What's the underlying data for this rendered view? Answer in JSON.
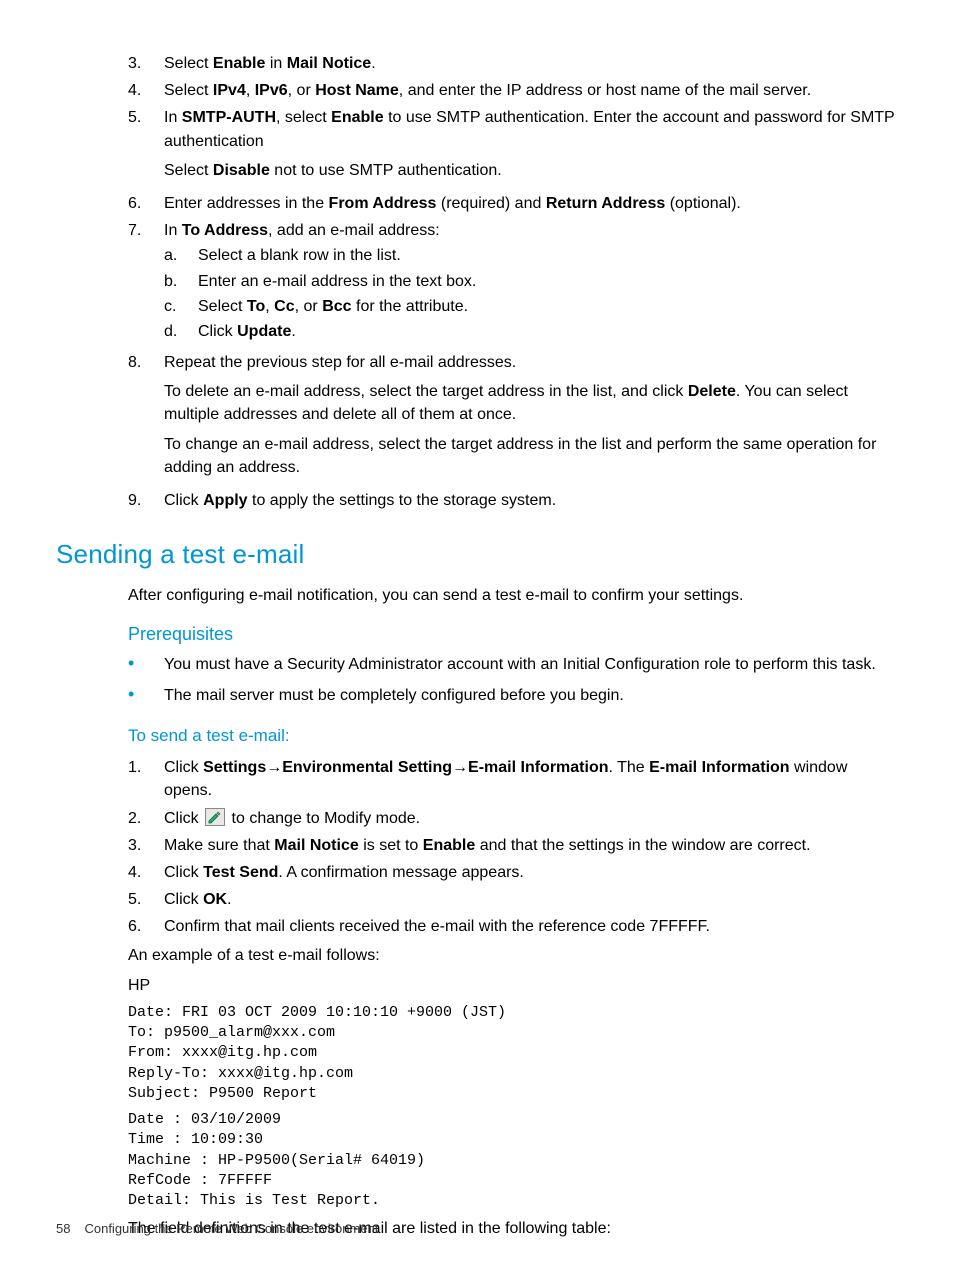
{
  "steps_top": {
    "s3": {
      "num": "3.",
      "pre": "Select ",
      "b1": "Enable",
      "mid": " in ",
      "b2": "Mail Notice",
      "post": "."
    },
    "s4": {
      "num": "4.",
      "pre": "Select ",
      "b1": "IPv4",
      "c1": ", ",
      "b2": "IPv6",
      "c2": ", or ",
      "b3": "Host Name",
      "post": ", and enter the IP address or host name of the mail server."
    },
    "s5": {
      "num": "5.",
      "line1_pre": "In ",
      "line1_b1": "SMTP-AUTH",
      "line1_mid": ", select ",
      "line1_b2": "Enable",
      "line1_post": " to use SMTP authentication. Enter the account and password for SMTP authentication",
      "line2_pre": "Select ",
      "line2_b": "Disable",
      "line2_post": " not to use SMTP authentication."
    },
    "s6": {
      "num": "6.",
      "pre": "Enter addresses in the ",
      "b1": "From Address",
      "mid": " (required) and ",
      "b2": "Return Address",
      "post": " (optional)."
    },
    "s7": {
      "num": "7.",
      "pre": "In ",
      "b1": "To Address",
      "post": ", add an e-mail address:",
      "a": {
        "l": "a.",
        "t": "Select a blank row in the list."
      },
      "b": {
        "l": "b.",
        "t": "Enter an e-mail address in the text box."
      },
      "c": {
        "l": "c.",
        "pre": "Select ",
        "b1": "To",
        "c1": ", ",
        "b2": "Cc",
        "c2": ", or ",
        "b3": "Bcc",
        "post": " for the attribute."
      },
      "d": {
        "l": "d.",
        "pre": "Click ",
        "b1": "Update",
        "post": "."
      }
    },
    "s8": {
      "num": "8.",
      "line1": "Repeat the previous step for all e-mail addresses.",
      "line2_pre": "To delete an e-mail address, select the target address in the list, and click ",
      "line2_b": "Delete",
      "line2_post": ". You can select multiple addresses and delete all of them at once.",
      "line3": "To change an e-mail address, select the target address in the list and perform the same operation for adding an address."
    },
    "s9": {
      "num": "9.",
      "pre": "Click ",
      "b1": "Apply",
      "post": " to apply the settings to the storage system."
    }
  },
  "h2_send": "Sending a test e-mail",
  "intro_send": "After configuring e-mail notification, you can send a test e-mail to confirm your settings.",
  "h3_prereq": "Prerequisites",
  "prereq": {
    "p1": "You must have a Security Administrator account with an Initial Configuration role to perform this task.",
    "p2": "The mail server must be completely configured before you begin."
  },
  "h4_tosend": "To send a test e-mail:",
  "send_steps": {
    "s1": {
      "num": "1.",
      "pre": "Click ",
      "b1": "Settings",
      "arr1": "→",
      "b2": "Environmental Setting",
      "arr2": "→",
      "b3": "E-mail Information",
      "mid": ". The ",
      "b4": "E-mail Information",
      "post": " window opens."
    },
    "s2": {
      "num": "2.",
      "pre": "Click ",
      "post": " to change to Modify mode."
    },
    "s3": {
      "num": "3.",
      "pre": "Make sure that ",
      "b1": "Mail Notice",
      "mid": " is set to ",
      "b2": "Enable",
      "post": " and that the settings in the window are correct."
    },
    "s4": {
      "num": "4.",
      "pre": "Click ",
      "b1": "Test Send",
      "post": ". A confirmation message appears."
    },
    "s5": {
      "num": "5.",
      "pre": "Click ",
      "b1": "OK",
      "post": "."
    },
    "s6": {
      "num": "6.",
      "t": "Confirm that mail clients received the e-mail with the reference code 7FFFFF."
    }
  },
  "example_intro": "An example of a test e-mail follows:",
  "hp_label": "HP",
  "code_block1": "Date: FRI 03 OCT 2009 10:10:10 +9000 (JST)\nTo: p9500_alarm@xxx.com\nFrom: xxxx@itg.hp.com\nReply-To: xxxx@itg.hp.com\nSubject: P9500 Report",
  "code_block2": "Date : 03/10/2009\nTime : 10:09:30\nMachine : HP-P9500(Serial# 64019)\nRefCode : 7FFFFF\nDetail: This is Test Report.",
  "table_intro": "The field definitions in the test e-mail are listed in the following table:",
  "footer_pagenum": "58",
  "footer_title": "Configuring the Remote Web Console environment"
}
